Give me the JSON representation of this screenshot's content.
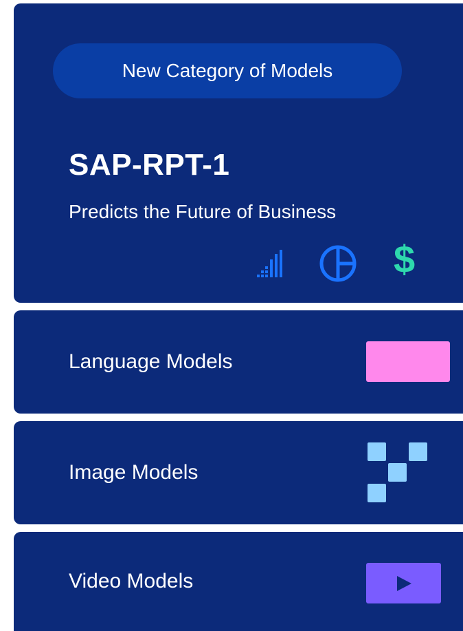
{
  "hero": {
    "badge": "New Category of Models",
    "title": "SAP-RPT-1",
    "subtitle": "Predicts the Future of Business",
    "icons": [
      "signal-bars-icon",
      "pie-chart-icon",
      "dollar-icon"
    ],
    "dollar_symbol": "$"
  },
  "models": [
    {
      "label": "Language Models",
      "icon": "pink-rectangle-icon"
    },
    {
      "label": "Image Models",
      "icon": "pixel-squares-icon"
    },
    {
      "label": "Video Models",
      "icon": "play-icon"
    }
  ],
  "colors": {
    "card_bg": "#0c2a7a",
    "pill_bg": "#0a3ea5",
    "icon_blue": "#1a73ff",
    "dollar_green": "#2ed8ad",
    "pink": "#ff88ec",
    "light_blue": "#8fd1ff",
    "purple": "#7a5cff"
  }
}
